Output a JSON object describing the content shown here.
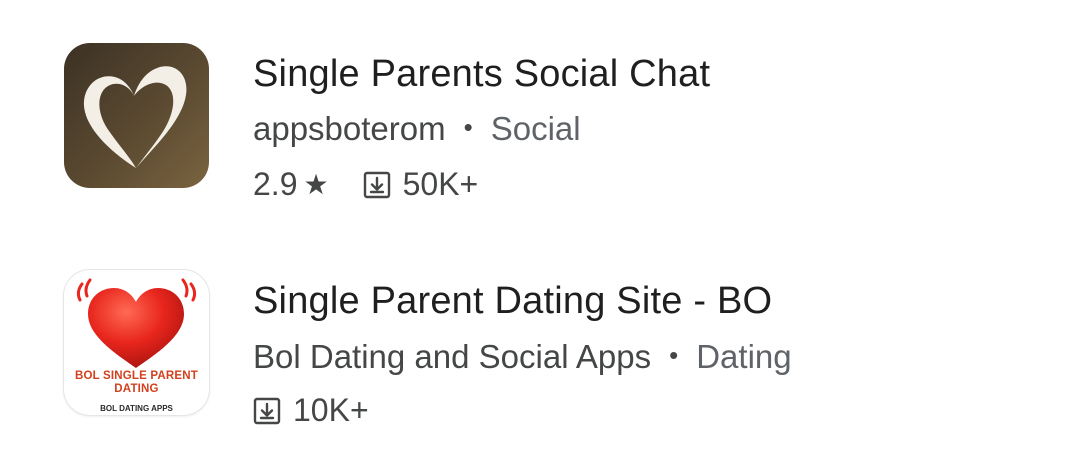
{
  "apps": [
    {
      "title": "Single Parents Social Chat",
      "developer": "appsboterom",
      "separator": "•",
      "category": "Social",
      "rating": "2.9",
      "rating_icon": "star-icon",
      "downloads": "50K+",
      "downloads_icon": "download-icon",
      "icon_colors": [
        "#3b3124",
        "#7a6440"
      ]
    },
    {
      "title": "Single Parent Dating Site - BO",
      "developer": "Bol Dating and Social Apps",
      "separator": "•",
      "category": "Dating",
      "downloads": "10K+",
      "downloads_icon": "download-icon",
      "icon_text_main": "BOL SINGLE PARENT DATING",
      "icon_text_sub": "BOL DATING APPS",
      "icon_colors": [
        "#e8261d",
        "#d2401e"
      ]
    }
  ]
}
